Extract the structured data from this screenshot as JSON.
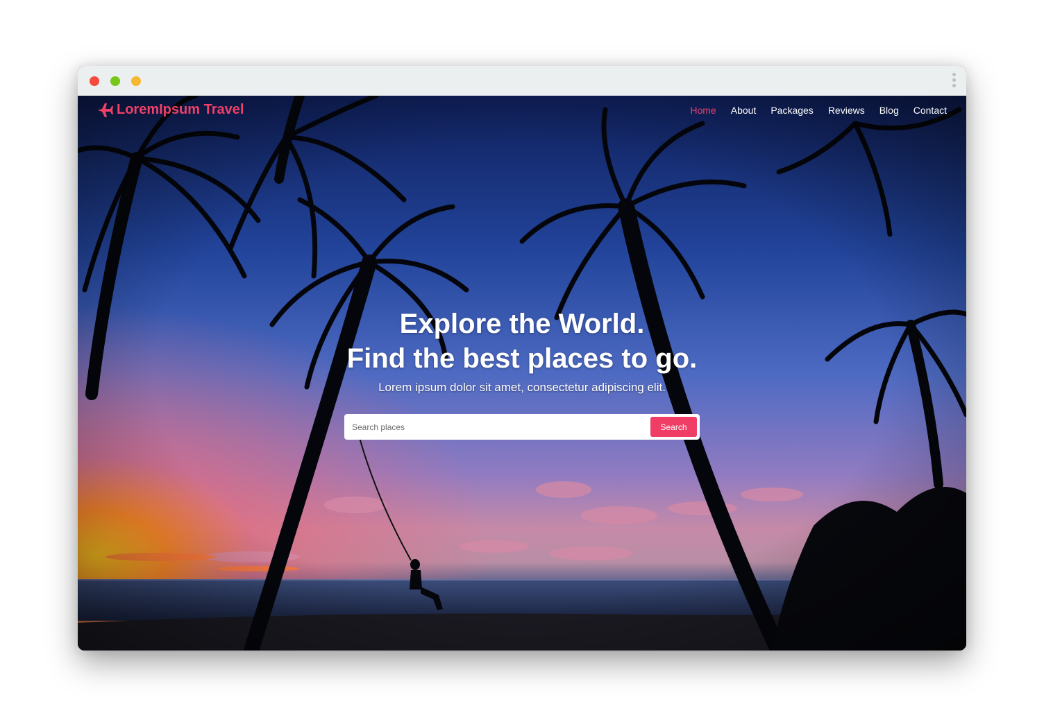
{
  "window": {
    "controls": [
      "close",
      "minimize",
      "maximize"
    ],
    "menu_icon": "kebab-menu-icon"
  },
  "brand": {
    "name": "LoremIpsum Travel",
    "icon": "airplane-icon",
    "color": "#ef4067"
  },
  "nav": {
    "items": [
      {
        "label": "Home",
        "active": true
      },
      {
        "label": "About",
        "active": false
      },
      {
        "label": "Packages",
        "active": false
      },
      {
        "label": "Reviews",
        "active": false
      },
      {
        "label": "Blog",
        "active": false
      },
      {
        "label": "Contact",
        "active": false
      }
    ],
    "active_color": "#f03f66"
  },
  "hero": {
    "headline_line1": "Explore the World.",
    "headline_line2": "Find the best places to go.",
    "subtitle": "Lorem ipsum dolor sit amet, consectetur adipiscing elit."
  },
  "search": {
    "placeholder": "Search places",
    "value": "",
    "button_label": "Search",
    "button_color": "#ef3d65"
  }
}
